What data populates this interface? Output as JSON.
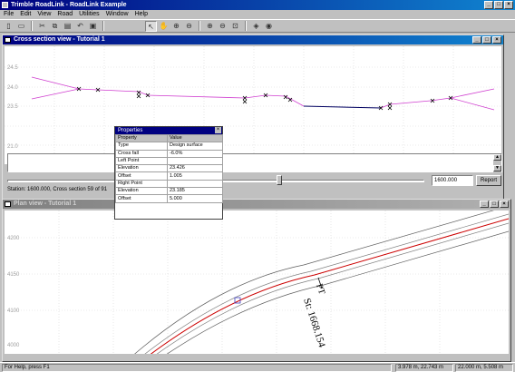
{
  "app": {
    "title": "Trimble RoadLink - RoadLink Example",
    "window_buttons": [
      "_",
      "□",
      "×"
    ]
  },
  "menu": [
    "File",
    "Edit",
    "View",
    "Road",
    "Utilities",
    "Window",
    "Help"
  ],
  "toolbar": {
    "buttons": [
      "new-icon",
      "open-icon",
      "cut-icon",
      "copy-icon",
      "paste-icon",
      "undo-icon",
      "window-icon",
      "pointer-icon",
      "pan-icon",
      "zoom-area-icon",
      "zoom-window-icon",
      "zoom-in-icon",
      "zoom-out-icon",
      "zoom-extents-icon",
      "layers-icon",
      "render-icon"
    ]
  },
  "cross_section": {
    "title": "Cross section view - Tutorial 1",
    "y_ticks": [
      "24.5",
      "24.0",
      "23.5",
      "21.0"
    ],
    "station_value": "1600.000",
    "report_label": "Report",
    "status": "Station: 1600.000, Cross section 59 of 91"
  },
  "plan": {
    "title": "Plan view - Tutorial 1",
    "y_ticks": [
      "4200",
      "4150",
      "4100",
      "4000"
    ],
    "label_pt": "PT",
    "label_station": "St: 1668.154"
  },
  "properties": {
    "title": "Properties",
    "header": [
      "Property",
      "Value"
    ],
    "rows": [
      [
        "Type",
        "Design surface"
      ],
      [
        "Cross fall",
        "-6.0%"
      ],
      [
        "Left Point",
        ""
      ],
      [
        "Elevation",
        "23.426"
      ],
      [
        "Offset",
        "1.005"
      ],
      [
        "Right Point",
        ""
      ],
      [
        "Elevation",
        "23.185"
      ],
      [
        "Offset",
        "5.000"
      ]
    ]
  },
  "statusbar": {
    "help": "For Help, press F1",
    "coords": "3.978 m, 22.743 m",
    "scale": "22.000 m, 5.508 m"
  },
  "colors": {
    "titlebar": "#000080",
    "design_line": "#d040d0",
    "profile_segment": "#000060",
    "alignment_red": "#cc0000"
  }
}
